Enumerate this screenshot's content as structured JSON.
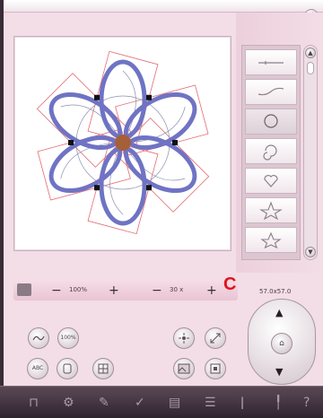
{
  "toolbar": {
    "zoom_value": "100%",
    "zoom_minus": "−",
    "zoom_plus": "+",
    "size_minus": "−",
    "size_value": "30 x",
    "size_plus": "+",
    "marker_label": "C",
    "size_readout": "57.0x57.0",
    "ok_icon": "checkmark-icon"
  },
  "stitch_list": {
    "items": [
      {
        "icon": "straight-stitch-icon"
      },
      {
        "icon": "curved-line-icon"
      },
      {
        "icon": "circle-icon",
        "selected": true
      },
      {
        "icon": "spiral-icon"
      },
      {
        "icon": "heart-icon"
      },
      {
        "icon": "star-icon"
      },
      {
        "icon": "star-outline-icon"
      }
    ]
  },
  "buttons": {
    "b1_icon": "wave-stitch-icon",
    "b2_label": "100%",
    "b3_label": "ABC",
    "b4_icon": "hoop-icon",
    "b5_icon": "hoop-grid-icon",
    "b6_icon": "center-icon",
    "b7_icon": "resize-icon",
    "b8_icon": "image-icon",
    "b9_icon": "frame-icon"
  },
  "colors": {
    "petal": "#6f73c4",
    "frame_line": "#e46a72",
    "center": "#a5603a",
    "marker": "#e0141e"
  }
}
